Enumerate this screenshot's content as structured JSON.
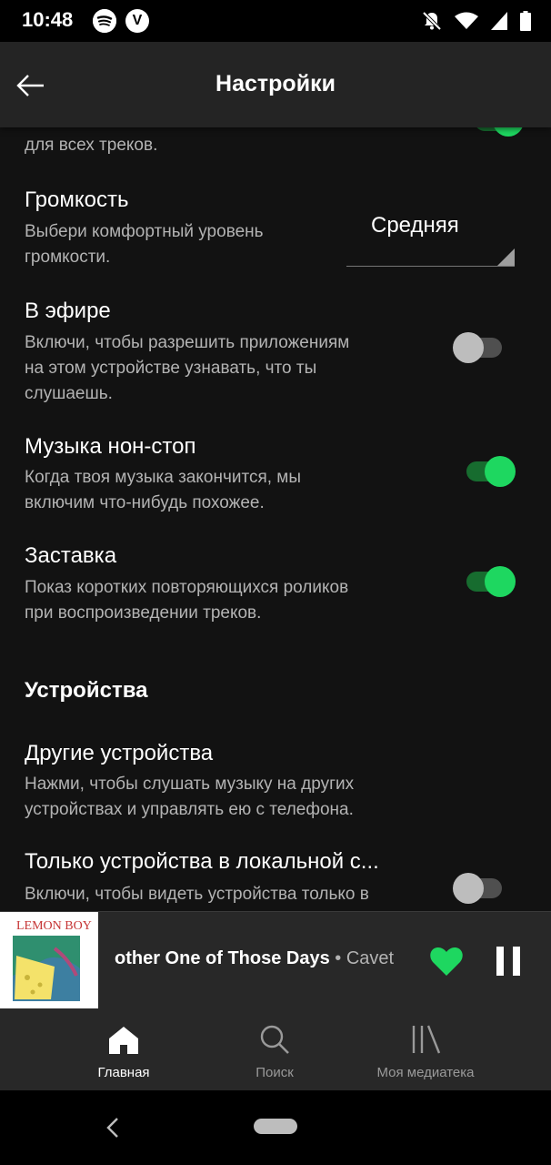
{
  "status_bar": {
    "time": "10:48",
    "app_icons": [
      "spotify-icon",
      "v-app-icon"
    ],
    "v_icon_letter": "V",
    "right_icons": [
      "notifications-off-icon",
      "wifi-icon",
      "signal-icon",
      "battery-icon"
    ]
  },
  "header": {
    "title": "Настройки",
    "back_icon": "arrow-left-icon"
  },
  "settings": {
    "partial_desc": "для всех треков.",
    "volume": {
      "title": "Громкость",
      "desc_line1": "Выбери комфортный уровень",
      "desc_line2": "громкости.",
      "value": "Средняя"
    },
    "on_air": {
      "title": "В эфире",
      "desc_line1": "Включи, чтобы разрешить приложениям",
      "desc_line2": "на этом устройстве узнавать, что ты",
      "desc_line3": "слушаешь.",
      "enabled": false
    },
    "autoplay": {
      "title": "Музыка нон-стоп",
      "desc_line1": "Когда твоя музыка закончится, мы",
      "desc_line2": "включим что-нибудь похожее.",
      "enabled": true
    },
    "canvas": {
      "title": "Заставка",
      "desc_line1": "Показ коротких повторяющихся роликов",
      "desc_line2": "при воспроизведении треков.",
      "enabled": true
    }
  },
  "devices_section": {
    "title": "Устройства",
    "other_devices": {
      "title": "Другие устройства",
      "desc_line1": "Нажми, чтобы слушать музыку на других",
      "desc_line2": "устройствах и управлять ею с телефона."
    },
    "local_only": {
      "title": "Только устройства в локальной с...",
      "desc_line1": "Включи, чтобы видеть устройства только в",
      "enabled": false
    }
  },
  "mini_player": {
    "track_visible": "other One of Those Days",
    "separator": "•",
    "artist_visible": "Cavet",
    "cover_text": "LEMON BOY",
    "liked": true
  },
  "bottom_nav": {
    "items": [
      {
        "label": "Главная",
        "icon": "home-icon",
        "active": true
      },
      {
        "label": "Поиск",
        "icon": "search-icon",
        "active": false
      },
      {
        "label": "Моя медиатека",
        "icon": "library-icon",
        "active": false
      }
    ]
  },
  "colors": {
    "accent": "#1ed760",
    "background": "#121212",
    "header": "#242424",
    "player": "#282828",
    "secondary_text": "#b3b3b3"
  }
}
